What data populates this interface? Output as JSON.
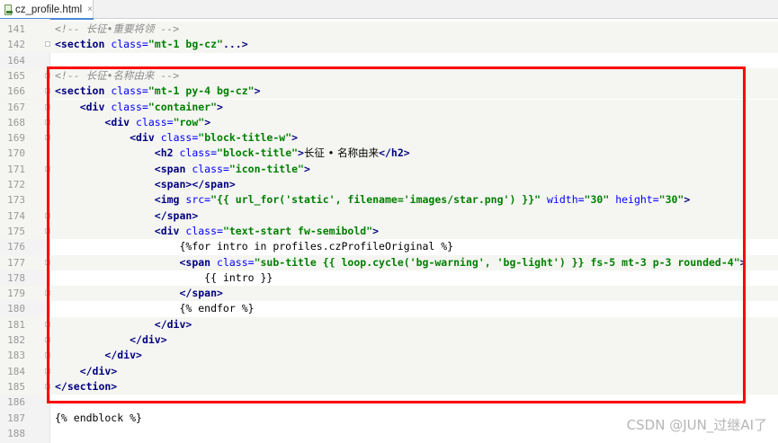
{
  "tab": {
    "filename": "cz_profile.html",
    "close": "×"
  },
  "lines": [
    {
      "num": "141",
      "hl": true,
      "tokens": [
        {
          "t": "cmt",
          "v": "<!-- "
        },
        {
          "t": "cmt zh",
          "v": "长征•重要将领"
        },
        {
          "t": "cmt",
          "v": " -->"
        }
      ]
    },
    {
      "num": "142",
      "hl": true,
      "tokens": [
        {
          "t": "tag",
          "v": "<section "
        },
        {
          "t": "attr",
          "v": "class="
        },
        {
          "t": "str",
          "v": "\"mt-1 bg-cz\""
        },
        {
          "t": "tag",
          "v": "...>"
        }
      ]
    },
    {
      "num": "164",
      "hl": false,
      "tokens": []
    },
    {
      "num": "165",
      "hl": true,
      "tokens": [
        {
          "t": "cmt",
          "v": "<!-- "
        },
        {
          "t": "cmt zh",
          "v": "长征•名称由来"
        },
        {
          "t": "cmt",
          "v": " -->"
        }
      ]
    },
    {
      "num": "166",
      "hl": true,
      "tokens": [
        {
          "t": "tag",
          "v": "<section "
        },
        {
          "t": "attr",
          "v": "class="
        },
        {
          "t": "str",
          "v": "\"mt-1 py-4 bg-cz\""
        },
        {
          "t": "tag",
          "v": ">"
        }
      ]
    },
    {
      "num": "167",
      "hl": true,
      "tokens": [
        {
          "t": "",
          "v": "    "
        },
        {
          "t": "tag",
          "v": "<div "
        },
        {
          "t": "attr",
          "v": "class="
        },
        {
          "t": "str",
          "v": "\"container\""
        },
        {
          "t": "tag",
          "v": ">"
        }
      ]
    },
    {
      "num": "168",
      "hl": true,
      "tokens": [
        {
          "t": "",
          "v": "        "
        },
        {
          "t": "tag",
          "v": "<div "
        },
        {
          "t": "attr",
          "v": "class="
        },
        {
          "t": "str",
          "v": "\"row\""
        },
        {
          "t": "tag",
          "v": ">"
        }
      ]
    },
    {
      "num": "169",
      "hl": true,
      "tokens": [
        {
          "t": "",
          "v": "            "
        },
        {
          "t": "tag",
          "v": "<div "
        },
        {
          "t": "attr",
          "v": "class="
        },
        {
          "t": "str",
          "v": "\"block-title-w\""
        },
        {
          "t": "tag",
          "v": ">"
        }
      ]
    },
    {
      "num": "170",
      "hl": true,
      "tokens": [
        {
          "t": "",
          "v": "                "
        },
        {
          "t": "tag",
          "v": "<h2 "
        },
        {
          "t": "attr",
          "v": "class="
        },
        {
          "t": "str",
          "v": "\"block-title\""
        },
        {
          "t": "tag",
          "v": ">"
        },
        {
          "t": "zh",
          "v": "长征 • 名称由来"
        },
        {
          "t": "tag",
          "v": "</h2>"
        }
      ]
    },
    {
      "num": "171",
      "hl": true,
      "tokens": [
        {
          "t": "",
          "v": "                "
        },
        {
          "t": "tag",
          "v": "<span "
        },
        {
          "t": "attr",
          "v": "class="
        },
        {
          "t": "str",
          "v": "\"icon-title\""
        },
        {
          "t": "tag",
          "v": ">"
        }
      ]
    },
    {
      "num": "172",
      "hl": true,
      "tokens": [
        {
          "t": "",
          "v": "                "
        },
        {
          "t": "tag",
          "v": "<span></span>"
        }
      ]
    },
    {
      "num": "173",
      "hl": true,
      "tokens": [
        {
          "t": "",
          "v": "                "
        },
        {
          "t": "tag",
          "v": "<img "
        },
        {
          "t": "attr",
          "v": "src="
        },
        {
          "t": "str",
          "v": "\"{{ url_for('static', filename='images/star.png') }}\""
        },
        {
          "t": "",
          "v": " "
        },
        {
          "t": "attr",
          "v": "width="
        },
        {
          "t": "str",
          "v": "\"30\""
        },
        {
          "t": "",
          "v": " "
        },
        {
          "t": "attr",
          "v": "height="
        },
        {
          "t": "str",
          "v": "\"30\""
        },
        {
          "t": "tag",
          "v": ">"
        }
      ]
    },
    {
      "num": "174",
      "hl": true,
      "tokens": [
        {
          "t": "",
          "v": "                "
        },
        {
          "t": "tag",
          "v": "</span>"
        }
      ]
    },
    {
      "num": "175",
      "hl": true,
      "tokens": [
        {
          "t": "",
          "v": "                "
        },
        {
          "t": "tag",
          "v": "<div "
        },
        {
          "t": "attr",
          "v": "class="
        },
        {
          "t": "str",
          "v": "\"text-start fw-semibold\""
        },
        {
          "t": "tag",
          "v": ">"
        }
      ]
    },
    {
      "num": "176",
      "hl": false,
      "tokens": [
        {
          "t": "",
          "v": "                    {%for intro in profiles.czProfileOriginal %}"
        }
      ]
    },
    {
      "num": "177",
      "hl": true,
      "tokens": [
        {
          "t": "",
          "v": "                    "
        },
        {
          "t": "tag",
          "v": "<span "
        },
        {
          "t": "attr",
          "v": "class="
        },
        {
          "t": "str",
          "v": "\"sub-title {{ loop.cycle('bg-warning', 'bg-light') }} fs-5 mt-3 p-3 rounded-4\""
        },
        {
          "t": "tag",
          "v": ">"
        }
      ]
    },
    {
      "num": "178",
      "hl": false,
      "tokens": [
        {
          "t": "",
          "v": "                        {{ intro }}"
        }
      ]
    },
    {
      "num": "179",
      "hl": true,
      "tokens": [
        {
          "t": "",
          "v": "                    "
        },
        {
          "t": "tag",
          "v": "</span>"
        }
      ]
    },
    {
      "num": "180",
      "hl": false,
      "tokens": [
        {
          "t": "",
          "v": "                    {% endfor %}"
        }
      ]
    },
    {
      "num": "181",
      "hl": true,
      "tokens": [
        {
          "t": "",
          "v": "                "
        },
        {
          "t": "tag",
          "v": "</div>"
        }
      ]
    },
    {
      "num": "182",
      "hl": true,
      "tokens": [
        {
          "t": "",
          "v": "            "
        },
        {
          "t": "tag",
          "v": "</div>"
        }
      ]
    },
    {
      "num": "183",
      "hl": true,
      "tokens": [
        {
          "t": "",
          "v": "        "
        },
        {
          "t": "tag",
          "v": "</div>"
        }
      ]
    },
    {
      "num": "184",
      "hl": true,
      "tokens": [
        {
          "t": "",
          "v": "    "
        },
        {
          "t": "tag",
          "v": "</div>"
        }
      ]
    },
    {
      "num": "185",
      "hl": true,
      "tokens": [
        {
          "t": "tag",
          "v": "</section>"
        }
      ]
    },
    {
      "num": "186",
      "hl": false,
      "tokens": []
    },
    {
      "num": "187",
      "hl": false,
      "tokens": [
        {
          "t": "",
          "v": "{% endblock %}"
        }
      ]
    },
    {
      "num": "188",
      "hl": false,
      "tokens": []
    }
  ],
  "watermark": "CSDN @JUN_过继AI了",
  "colors": {
    "highlight_box": "#ff0000",
    "tag": "#000080",
    "attribute": "#0000ff",
    "string": "#008000",
    "comment": "#8c8c8c"
  }
}
